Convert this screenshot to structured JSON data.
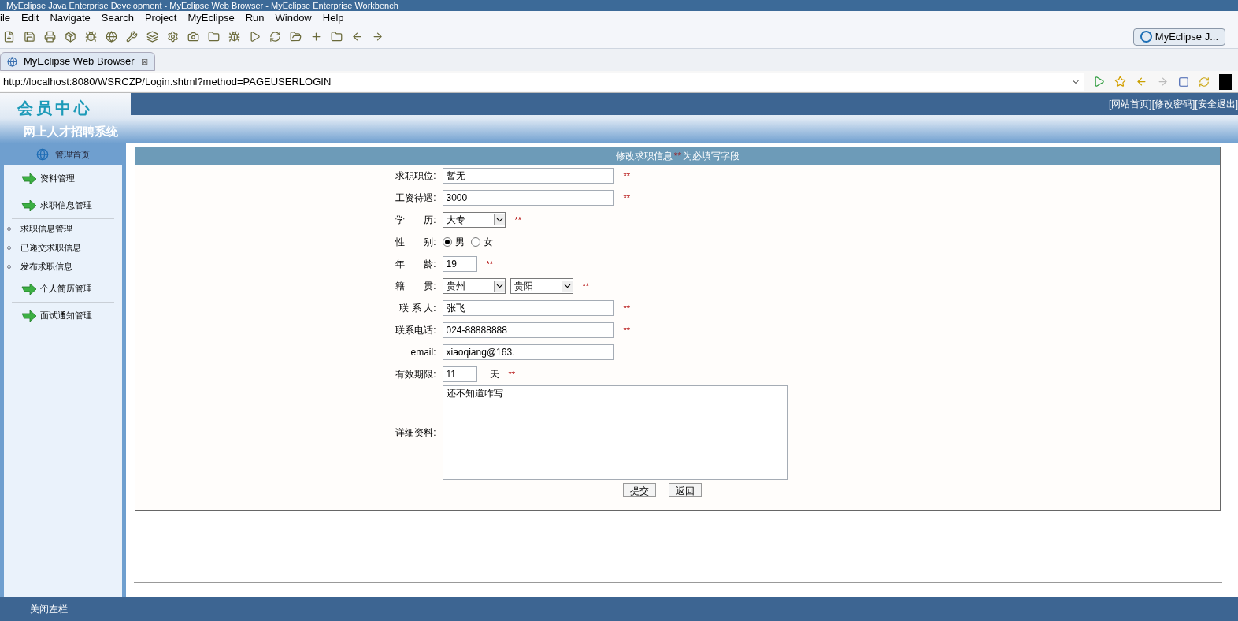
{
  "window": {
    "title": "MyEclipse Java Enterprise Development - MyEclipse Web Browser - MyEclipse Enterprise Workbench"
  },
  "menu": [
    "ile",
    "Edit",
    "Navigate",
    "Search",
    "Project",
    "MyEclipse",
    "Run",
    "Window",
    "Help"
  ],
  "perspective": {
    "label": "MyEclipse J..."
  },
  "editor_tab": {
    "label": "MyEclipse Web Browser",
    "close": "⊠"
  },
  "address": {
    "url": "http://localhost:8080/WSRCZP/Login.shtml?method=PAGEUSERLOGIN"
  },
  "page": {
    "logo": "会员中心",
    "subtitle": "网上人才招聘系统",
    "top_links": [
      "[网站首页]",
      "[修改密码]",
      "[安全退出]"
    ],
    "sidebar": {
      "home": "管理首页",
      "items": [
        {
          "label": "资料管理"
        },
        {
          "label": "求职信息管理",
          "children": [
            {
              "label": "求职信息管理"
            },
            {
              "label": "已递交求职信息"
            },
            {
              "label": "发布求职信息"
            }
          ]
        },
        {
          "label": "个人简历管理"
        },
        {
          "label": "面试通知管理"
        }
      ]
    },
    "form": {
      "title": "修改求职信息",
      "title_mark": "**",
      "title_suffix": "为必填写字段",
      "rows": [
        {
          "kind": "text",
          "label": "求职职位:",
          "value": "暂无",
          "mark": "**"
        },
        {
          "kind": "text",
          "label": "工资待遇:",
          "value": "3000",
          "mark": "**"
        },
        {
          "kind": "select",
          "label": "学　　历:",
          "options": [
            "大专"
          ],
          "mark": "**"
        },
        {
          "kind": "radio",
          "label": "性　　别:",
          "options": [
            {
              "label": "男",
              "selected": true
            },
            {
              "label": "女",
              "selected": false
            }
          ]
        },
        {
          "kind": "short_text",
          "label": "年　　龄:",
          "value": "19",
          "mark": "**"
        },
        {
          "kind": "select",
          "label": "籍　　贯:",
          "options": [
            "贵州",
            "贵阳"
          ],
          "mark": "**"
        },
        {
          "kind": "text",
          "label": "联 系 人:",
          "value": "张飞",
          "mark": "**"
        },
        {
          "kind": "text",
          "label": "联系电话:",
          "value": "024-88888888",
          "mark": "**"
        },
        {
          "kind": "text",
          "label": "email:",
          "value": "xiaoqiang@163."
        },
        {
          "kind": "short_text",
          "label": "有效期限:",
          "value": "11",
          "suffix": "天",
          "mark": "**"
        },
        {
          "kind": "textarea",
          "label": "详细资料:",
          "value": "还不知道咋写"
        }
      ],
      "buttons": [
        "提交",
        "返回"
      ]
    },
    "footer": "关闭左栏"
  }
}
